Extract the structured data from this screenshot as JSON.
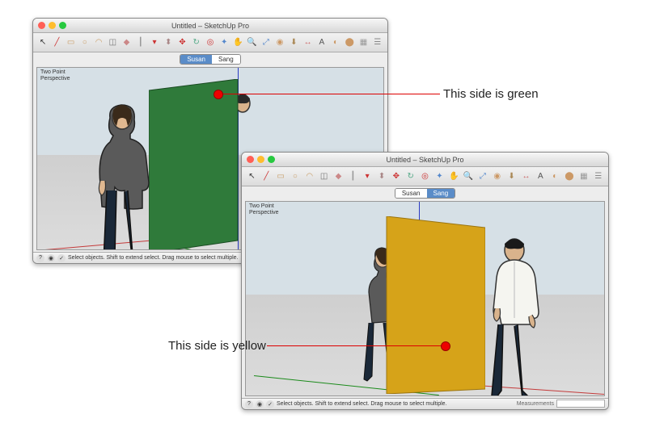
{
  "app_title": "Untitled – SketchUp Pro",
  "viewport_label_line1": "Two Point",
  "viewport_label_line2": "Perspective",
  "status_text": "Select objects. Shift to extend select. Drag mouse to select multiple.",
  "measurements_label": "Measurements",
  "tabs": {
    "susan": "Susan",
    "sang": "Sang"
  },
  "annot": {
    "green": "This side is green",
    "yellow": "This side is yellow"
  },
  "panel_colors": {
    "front": "#2f7a3a",
    "back": "#d6a319"
  },
  "toolbar_icons": [
    {
      "name": "select-arrow-icon",
      "glyph": "↖",
      "color": "#333"
    },
    {
      "name": "line-tool-icon",
      "glyph": "╱",
      "color": "#c33"
    },
    {
      "name": "rectangle-tool-icon",
      "glyph": "▭",
      "color": "#c99d66"
    },
    {
      "name": "circle-tool-icon",
      "glyph": "○",
      "color": "#c99d66"
    },
    {
      "name": "arc-tool-icon",
      "glyph": "◠",
      "color": "#c99d66"
    },
    {
      "name": "make-component-icon",
      "glyph": "◫",
      "color": "#777"
    },
    {
      "name": "eraser-icon",
      "glyph": "◆",
      "color": "#c88"
    },
    {
      "name": "tape-measure-icon",
      "glyph": "┃",
      "color": "#999"
    },
    {
      "name": "paint-bucket-icon",
      "glyph": "▾",
      "color": "#c33"
    },
    {
      "name": "push-pull-icon",
      "glyph": "⬍",
      "color": "#a88"
    },
    {
      "name": "move-tool-icon",
      "glyph": "✥",
      "color": "#c33"
    },
    {
      "name": "rotate-tool-icon",
      "glyph": "↻",
      "color": "#5a8"
    },
    {
      "name": "offset-tool-icon",
      "glyph": "◎",
      "color": "#c33"
    },
    {
      "name": "orbit-icon",
      "glyph": "✦",
      "color": "#58c"
    },
    {
      "name": "pan-icon",
      "glyph": "✋",
      "color": "#c99"
    },
    {
      "name": "zoom-icon",
      "glyph": "🔍",
      "color": "#333"
    },
    {
      "name": "zoom-extents-icon",
      "glyph": "⤢",
      "color": "#58c"
    },
    {
      "name": "add-location-icon",
      "glyph": "◉",
      "color": "#c96"
    },
    {
      "name": "get-models-icon",
      "glyph": "⬇",
      "color": "#a85"
    },
    {
      "name": "dimensions-icon",
      "glyph": "↔",
      "color": "#c66"
    },
    {
      "name": "text-icon",
      "glyph": "A",
      "color": "#555"
    },
    {
      "name": "section-icon",
      "glyph": "◐",
      "color": "#c96"
    },
    {
      "name": "walk-icon",
      "glyph": "⬤",
      "color": "#c96"
    },
    {
      "name": "layers-icon",
      "glyph": "▦",
      "color": "#999"
    },
    {
      "name": "outliner-icon",
      "glyph": "☰",
      "color": "#888"
    }
  ]
}
